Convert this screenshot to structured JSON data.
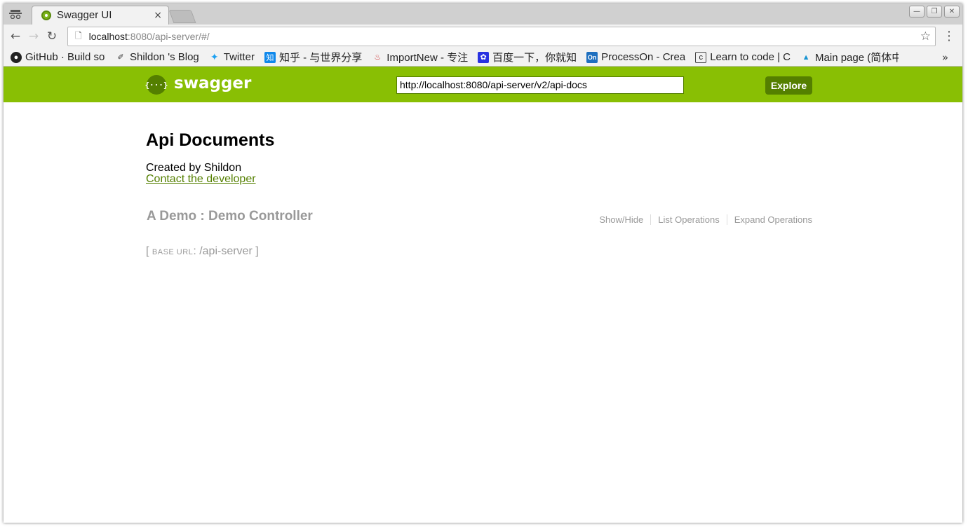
{
  "browser": {
    "tab_title": "Swagger UI",
    "tab_close": "×",
    "address_host": "localhost",
    "address_rest": ":8080/api-server/#/",
    "bookmarks": [
      {
        "label": "GitHub · Build sof",
        "icon": "github-icon",
        "color": "#222222",
        "glyph": "●"
      },
      {
        "label": "Shildon 's Blog",
        "icon": "blog-icon",
        "color": "#ffffff",
        "glyph": "✐"
      },
      {
        "label": "Twitter",
        "icon": "twitter-icon",
        "color": "#1da1f2",
        "glyph": "✦"
      },
      {
        "label": "知乎 - 与世界分享",
        "icon": "zhihu-icon",
        "color": "#0f88eb",
        "glyph": "知"
      },
      {
        "label": "ImportNew - 专注",
        "icon": "importnew-icon",
        "color": "#ffffff",
        "glyph": "♨"
      },
      {
        "label": "百度一下，你就知",
        "icon": "baidu-icon",
        "color": "#2932e1",
        "glyph": "✿"
      },
      {
        "label": "ProcessOn - Crea",
        "icon": "processon-icon",
        "color": "#1e6fbf",
        "glyph": "On"
      },
      {
        "label": "Learn to code | C",
        "icon": "freecodecamp-icon",
        "color": "#ffffff",
        "glyph": "c"
      },
      {
        "label": "Main page (简体中",
        "icon": "archlinux-icon",
        "color": "#ffffff",
        "glyph": "▲"
      }
    ],
    "more": "»"
  },
  "swagger": {
    "brand": "swagger",
    "logo_glyph": "{···}",
    "api_url": "http://localhost:8080/api-server/v2/api-docs",
    "explore_label": "Explore",
    "accent": "#89bf04",
    "dark_accent": "#547f00"
  },
  "info": {
    "title": "Api Documents",
    "created_by": "Created by Shildon",
    "contact": "Contact the developer"
  },
  "resource": {
    "heading": "A Demo : Demo Controller",
    "ops": [
      "Show/Hide",
      "List Operations",
      "Expand Operations"
    ]
  },
  "base_url": {
    "open": "[ ",
    "label": "BASE URL",
    "value": ": /api-server ]"
  }
}
